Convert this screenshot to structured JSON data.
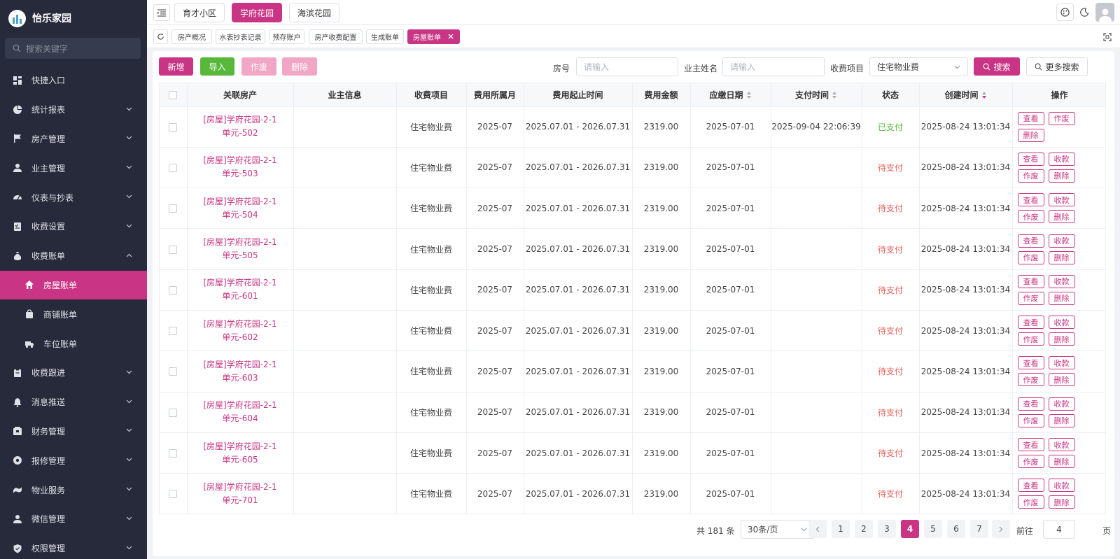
{
  "app": {
    "title": "怡乐家园"
  },
  "sidebar": {
    "search_placeholder": "搜索关键字",
    "items": [
      {
        "label": "快捷入口",
        "icon": "dashboard-icon",
        "expandable": false
      },
      {
        "label": "统计报表",
        "icon": "pie-chart-icon",
        "expandable": true
      },
      {
        "label": "房产管理",
        "icon": "flag-icon",
        "expandable": true
      },
      {
        "label": "业主管理",
        "icon": "user-icon",
        "expandable": true
      },
      {
        "label": "仪表与抄表",
        "icon": "gauge-icon",
        "expandable": true
      },
      {
        "label": "收费设置",
        "icon": "checklist-icon",
        "expandable": true
      },
      {
        "label": "收费账单",
        "icon": "money-bag-icon",
        "expandable": true,
        "expanded": true
      },
      {
        "label": "收费跟进",
        "icon": "clipboard-icon",
        "expandable": true
      },
      {
        "label": "消息推送",
        "icon": "bell-icon",
        "expandable": true
      },
      {
        "label": "财务管理",
        "icon": "wallet-icon",
        "expandable": true
      },
      {
        "label": "报修管理",
        "icon": "gear-icon",
        "expandable": true
      },
      {
        "label": "物业服务",
        "icon": "service-icon",
        "expandable": true
      },
      {
        "label": "微信管理",
        "icon": "user-icon",
        "expandable": true
      },
      {
        "label": "权限管理",
        "icon": "shield-icon",
        "expandable": true
      }
    ],
    "sub_items": [
      {
        "label": "房屋账单",
        "icon": "home-icon",
        "active": true
      },
      {
        "label": "商铺账单",
        "icon": "shopping-bag-icon",
        "active": false
      },
      {
        "label": "车位账单",
        "icon": "truck-icon",
        "active": false
      }
    ]
  },
  "header": {
    "projects": [
      "育才小区",
      "学府花园",
      "海滨花园"
    ],
    "active_project": "学府花园"
  },
  "tags": {
    "items": [
      "房产概况",
      "水表抄表记录",
      "预存账户",
      "房产收费配置",
      "生成账单"
    ],
    "active": "房屋账单"
  },
  "toolbar": {
    "add": "新增",
    "import": "导入",
    "void": "作废",
    "delete": "删除"
  },
  "filters": {
    "room_label": "房号",
    "room_placeholder": "请输入",
    "owner_label": "业主姓名",
    "owner_placeholder": "请输入",
    "item_label": "收费项目",
    "item_value": "住宅物业费",
    "search": "搜索",
    "more_search": "更多搜索"
  },
  "table": {
    "columns": [
      "关联房产",
      "业主信息",
      "收费项目",
      "费用所属月",
      "费用起止时间",
      "费用金额",
      "应缴日期",
      "支付时间",
      "状态",
      "创建时间",
      "操作"
    ],
    "rows": [
      {
        "room": "[房屋]学府花园-2-1单元-502",
        "owner": "",
        "item": "住宅物业费",
        "month": "2025-07",
        "period": "2025.07.01 - 2026.07.31",
        "amount": "2319.00",
        "due": "2025-07-01",
        "paid_at": "2025-09-04 22:06:39",
        "status": "已支付",
        "paid": true,
        "created": "2025-08-24 13:01:34",
        "ops": [
          "查看",
          "作废",
          "删除"
        ]
      },
      {
        "room": "[房屋]学府花园-2-1单元-503",
        "owner": "",
        "item": "住宅物业费",
        "month": "2025-07",
        "period": "2025.07.01 - 2026.07.31",
        "amount": "2319.00",
        "due": "2025-07-01",
        "paid_at": "",
        "status": "待支付",
        "paid": false,
        "created": "2025-08-24 13:01:34",
        "ops": [
          "查看",
          "收款",
          "作废",
          "删除"
        ]
      },
      {
        "room": "[房屋]学府花园-2-1单元-504",
        "owner": "",
        "item": "住宅物业费",
        "month": "2025-07",
        "period": "2025.07.01 - 2026.07.31",
        "amount": "2319.00",
        "due": "2025-07-01",
        "paid_at": "",
        "status": "待支付",
        "paid": false,
        "created": "2025-08-24 13:01:34",
        "ops": [
          "查看",
          "收款",
          "作废",
          "删除"
        ]
      },
      {
        "room": "[房屋]学府花园-2-1单元-505",
        "owner": "",
        "item": "住宅物业费",
        "month": "2025-07",
        "period": "2025.07.01 - 2026.07.31",
        "amount": "2319.00",
        "due": "2025-07-01",
        "paid_at": "",
        "status": "待支付",
        "paid": false,
        "created": "2025-08-24 13:01:34",
        "ops": [
          "查看",
          "收款",
          "作废",
          "删除"
        ]
      },
      {
        "room": "[房屋]学府花园-2-1单元-601",
        "owner": "",
        "item": "住宅物业费",
        "month": "2025-07",
        "period": "2025.07.01 - 2026.07.31",
        "amount": "2319.00",
        "due": "2025-07-01",
        "paid_at": "",
        "status": "待支付",
        "paid": false,
        "created": "2025-08-24 13:01:34",
        "ops": [
          "查看",
          "收款",
          "作废",
          "删除"
        ]
      },
      {
        "room": "[房屋]学府花园-2-1单元-602",
        "owner": "",
        "item": "住宅物业费",
        "month": "2025-07",
        "period": "2025.07.01 - 2026.07.31",
        "amount": "2319.00",
        "due": "2025-07-01",
        "paid_at": "",
        "status": "待支付",
        "paid": false,
        "created": "2025-08-24 13:01:34",
        "ops": [
          "查看",
          "收款",
          "作废",
          "删除"
        ]
      },
      {
        "room": "[房屋]学府花园-2-1单元-603",
        "owner": "",
        "item": "住宅物业费",
        "month": "2025-07",
        "period": "2025.07.01 - 2026.07.31",
        "amount": "2319.00",
        "due": "2025-07-01",
        "paid_at": "",
        "status": "待支付",
        "paid": false,
        "created": "2025-08-24 13:01:34",
        "ops": [
          "查看",
          "收款",
          "作废",
          "删除"
        ]
      },
      {
        "room": "[房屋]学府花园-2-1单元-604",
        "owner": "",
        "item": "住宅物业费",
        "month": "2025-07",
        "period": "2025.07.01 - 2026.07.31",
        "amount": "2319.00",
        "due": "2025-07-01",
        "paid_at": "",
        "status": "待支付",
        "paid": false,
        "created": "2025-08-24 13:01:34",
        "ops": [
          "查看",
          "收款",
          "作废",
          "删除"
        ]
      },
      {
        "room": "[房屋]学府花园-2-1单元-605",
        "owner": "",
        "item": "住宅物业费",
        "month": "2025-07",
        "period": "2025.07.01 - 2026.07.31",
        "amount": "2319.00",
        "due": "2025-07-01",
        "paid_at": "",
        "status": "待支付",
        "paid": false,
        "created": "2025-08-24 13:01:34",
        "ops": [
          "查看",
          "收款",
          "作废",
          "删除"
        ]
      },
      {
        "room": "[房屋]学府花园-2-1单元-701",
        "owner": "",
        "item": "住宅物业费",
        "month": "2025-07",
        "period": "2025.07.01 - 2026.07.31",
        "amount": "2319.00",
        "due": "2025-07-01",
        "paid_at": "",
        "status": "待支付",
        "paid": false,
        "created": "2025-08-24 13:01:34",
        "ops": [
          "查看",
          "收款",
          "作废",
          "删除"
        ]
      }
    ]
  },
  "pagination": {
    "total": "共 181 条",
    "page_size": "30条/页",
    "pages": [
      "1",
      "2",
      "3",
      "4",
      "5",
      "6",
      "7"
    ],
    "current": "4",
    "goto_label": "前往",
    "goto_value": "4",
    "goto_unit": "页"
  },
  "colors": {
    "accent": "#c93584",
    "success": "#58b83b",
    "danger": "#e8615a",
    "sidebar_bg": "#262a3a"
  }
}
